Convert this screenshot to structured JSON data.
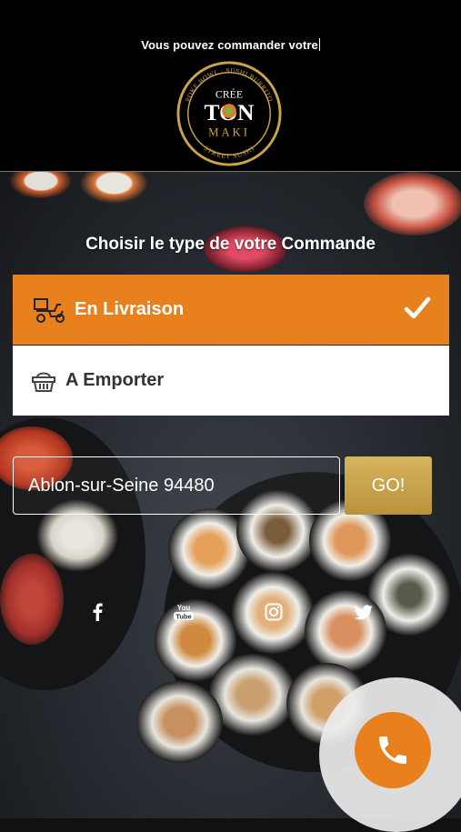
{
  "header": {
    "text": "Vous pouvez commander votre",
    "logo": {
      "top": "CRÉE",
      "main": "TON",
      "sub": "MAKI",
      "ring_top": "POKE BOWL · SUSHI BURRITO",
      "ring_bottom": "STREET SUSHI"
    }
  },
  "order": {
    "title": "Choisir le type de votre Commande",
    "options": [
      {
        "label": "En Livraison",
        "selected": true,
        "icon": "delivery-scooter-icon"
      },
      {
        "label": "A Emporter",
        "selected": false,
        "icon": "basket-icon"
      }
    ]
  },
  "address": {
    "value": "Ablon-sur-Seine 94480",
    "button": "GO!"
  },
  "social": [
    "facebook-icon",
    "youtube-icon",
    "instagram-icon",
    "twitter-icon"
  ],
  "colors": {
    "accent": "#e8811d",
    "gold": "#c9a449",
    "header_bg": "#000000"
  }
}
